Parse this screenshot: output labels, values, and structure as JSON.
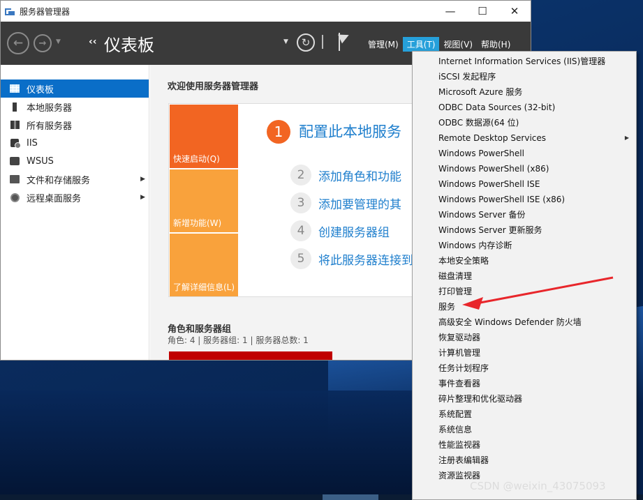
{
  "window": {
    "title": "服务器管理器",
    "controls": {
      "minimize": "—",
      "maximize": "☐",
      "close": "✕"
    }
  },
  "toolbar": {
    "back": "←",
    "forward": "→",
    "breadcrumb_arrows": "‹‹",
    "breadcrumb": "仪表板",
    "refresh": "↻",
    "menus": [
      "管理(M)",
      "工具(T)",
      "视图(V)",
      "帮助(H)"
    ],
    "active_menu": "工具(T)"
  },
  "sidebar": {
    "items": [
      {
        "label": "仪表板",
        "icon": "dashboard-icon",
        "active": true
      },
      {
        "label": "本地服务器",
        "icon": "server-icon"
      },
      {
        "label": "所有服务器",
        "icon": "servers-icon"
      },
      {
        "label": "IIS",
        "icon": "iis-icon"
      },
      {
        "label": "WSUS",
        "icon": "wsus-icon"
      },
      {
        "label": "文件和存储服务",
        "icon": "file-storage-icon",
        "expandable": true
      },
      {
        "label": "远程桌面服务",
        "icon": "remote-desktop-icon",
        "expandable": true
      }
    ]
  },
  "main": {
    "welcome": "欢迎使用服务器管理器",
    "tiles": [
      "快速启动(Q)",
      "新增功能(W)",
      "了解详细信息(L)"
    ],
    "steps": [
      {
        "num": "1",
        "text": "配置此本地服务"
      },
      {
        "num": "2",
        "text": "添加角色和功能"
      },
      {
        "num": "3",
        "text": "添加要管理的其"
      },
      {
        "num": "4",
        "text": "创建服务器组"
      },
      {
        "num": "5",
        "text": "将此服务器连接到"
      }
    ],
    "roles_title": "角色和服务器组",
    "roles_subtitle": "角色: 4 | 服务器组: 1 | 服务器总数: 1"
  },
  "tools_menu": {
    "items": [
      "Internet Information Services (IIS)管理器",
      "iSCSI 发起程序",
      "Microsoft Azure 服务",
      "ODBC Data Sources (32-bit)",
      "ODBC 数据源(64 位)",
      "Remote Desktop Services",
      "Windows PowerShell",
      "Windows PowerShell (x86)",
      "Windows PowerShell ISE",
      "Windows PowerShell ISE (x86)",
      "Windows Server 备份",
      "Windows Server 更新服务",
      "Windows 内存诊断",
      "本地安全策略",
      "磁盘清理",
      "打印管理",
      "服务",
      "高级安全 Windows Defender 防火墙",
      "恢复驱动器",
      "计算机管理",
      "任务计划程序",
      "事件查看器",
      "碎片整理和优化驱动器",
      "系统配置",
      "系统信息",
      "性能监视器",
      "注册表编辑器",
      "资源监视器"
    ],
    "submenu_item": "Remote Desktop Services",
    "submenu_arrow": "▶",
    "highlighted_target": "服务"
  },
  "annotation": {
    "arrow_color": "#e8262b"
  },
  "watermark": "CSDN @weixin_43075093",
  "colors": {
    "accent": "#0a6ec8",
    "menu_active": "#26a0da",
    "tile_orange": "#f26522",
    "tile_light_orange": "#f9a23c",
    "link_blue": "#1f7fcd",
    "role_red": "#c00000"
  }
}
